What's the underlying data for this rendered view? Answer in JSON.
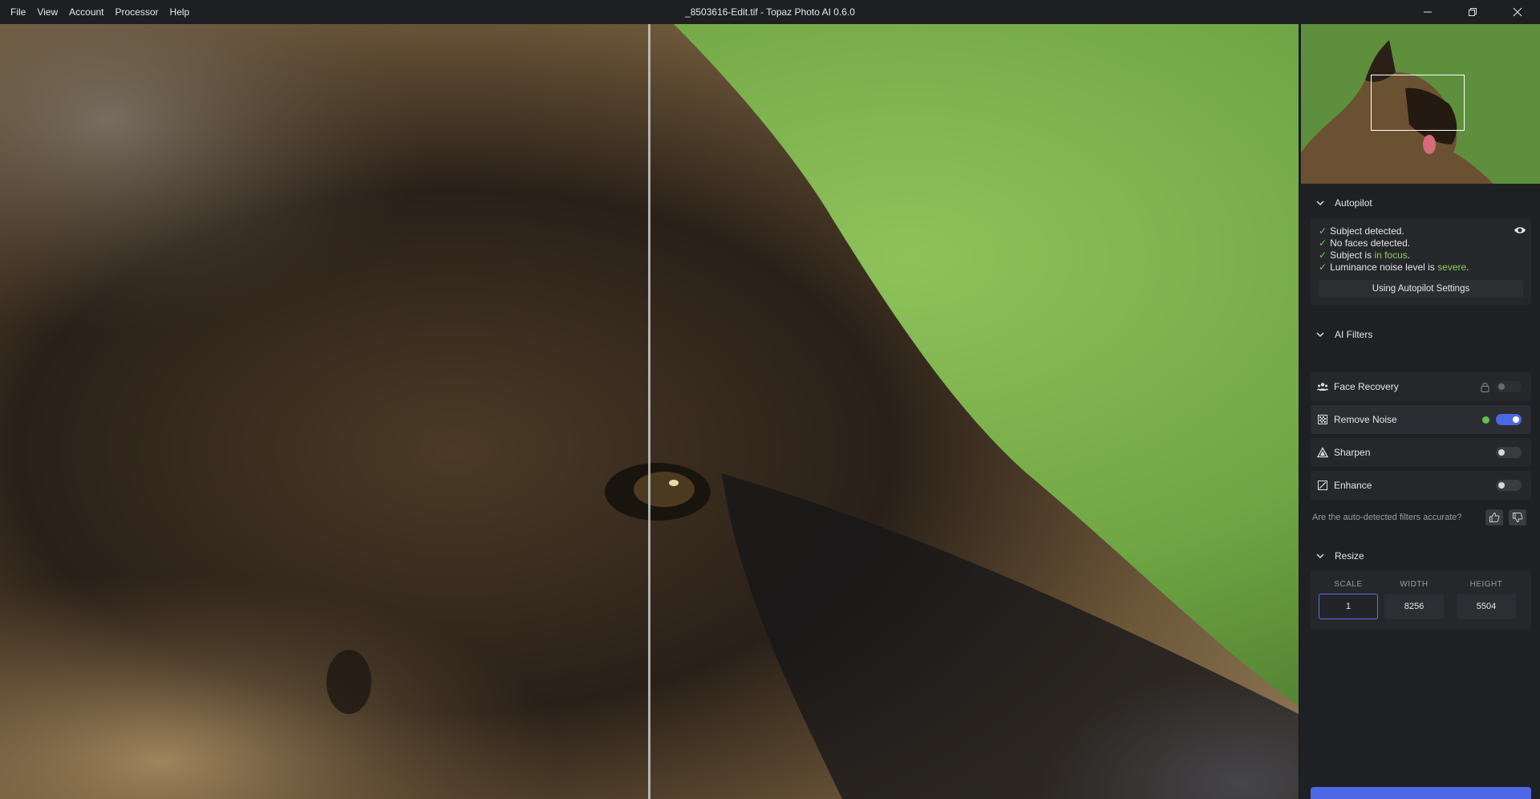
{
  "menu": [
    "File",
    "View",
    "Account",
    "Processor",
    "Help"
  ],
  "window_title": "_8503616-Edit.tif - Topaz Photo AI 0.6.0",
  "window_controls": [
    "minimize-icon",
    "restore-icon",
    "close-icon"
  ],
  "autopilot": {
    "title": "Autopilot",
    "lines": [
      {
        "check": "✓",
        "text": "Subject detected."
      },
      {
        "check": "✓",
        "text": "No faces detected."
      },
      {
        "check": "✓",
        "pre": "Subject is ",
        "highlight": "in focus",
        "post": "."
      },
      {
        "check": "✓",
        "pre": "Luminance noise level is ",
        "highlight": "severe",
        "post": "."
      }
    ],
    "settings_button": "Using Autopilot Settings"
  },
  "ai_filters": {
    "title": "AI Filters",
    "items": [
      {
        "label": "Face Recovery",
        "icon": "faces-icon",
        "enabled": false,
        "locked": true
      },
      {
        "label": "Remove Noise",
        "icon": "noise-icon",
        "enabled": true,
        "status": "green"
      },
      {
        "label": "Sharpen",
        "icon": "sharpen-icon",
        "enabled": false
      },
      {
        "label": "Enhance",
        "icon": "enhance-icon",
        "enabled": false
      }
    ],
    "feedback_question": "Are the auto-detected filters accurate?"
  },
  "resize": {
    "title": "Resize",
    "headers": [
      "SCALE",
      "WIDTH",
      "HEIGHT"
    ],
    "values": [
      "1",
      "8256",
      "5504"
    ]
  },
  "colors": {
    "accent": "#4d68e6",
    "highlight_green": "#8fcf5a",
    "panel_bg": "#1f2023"
  }
}
